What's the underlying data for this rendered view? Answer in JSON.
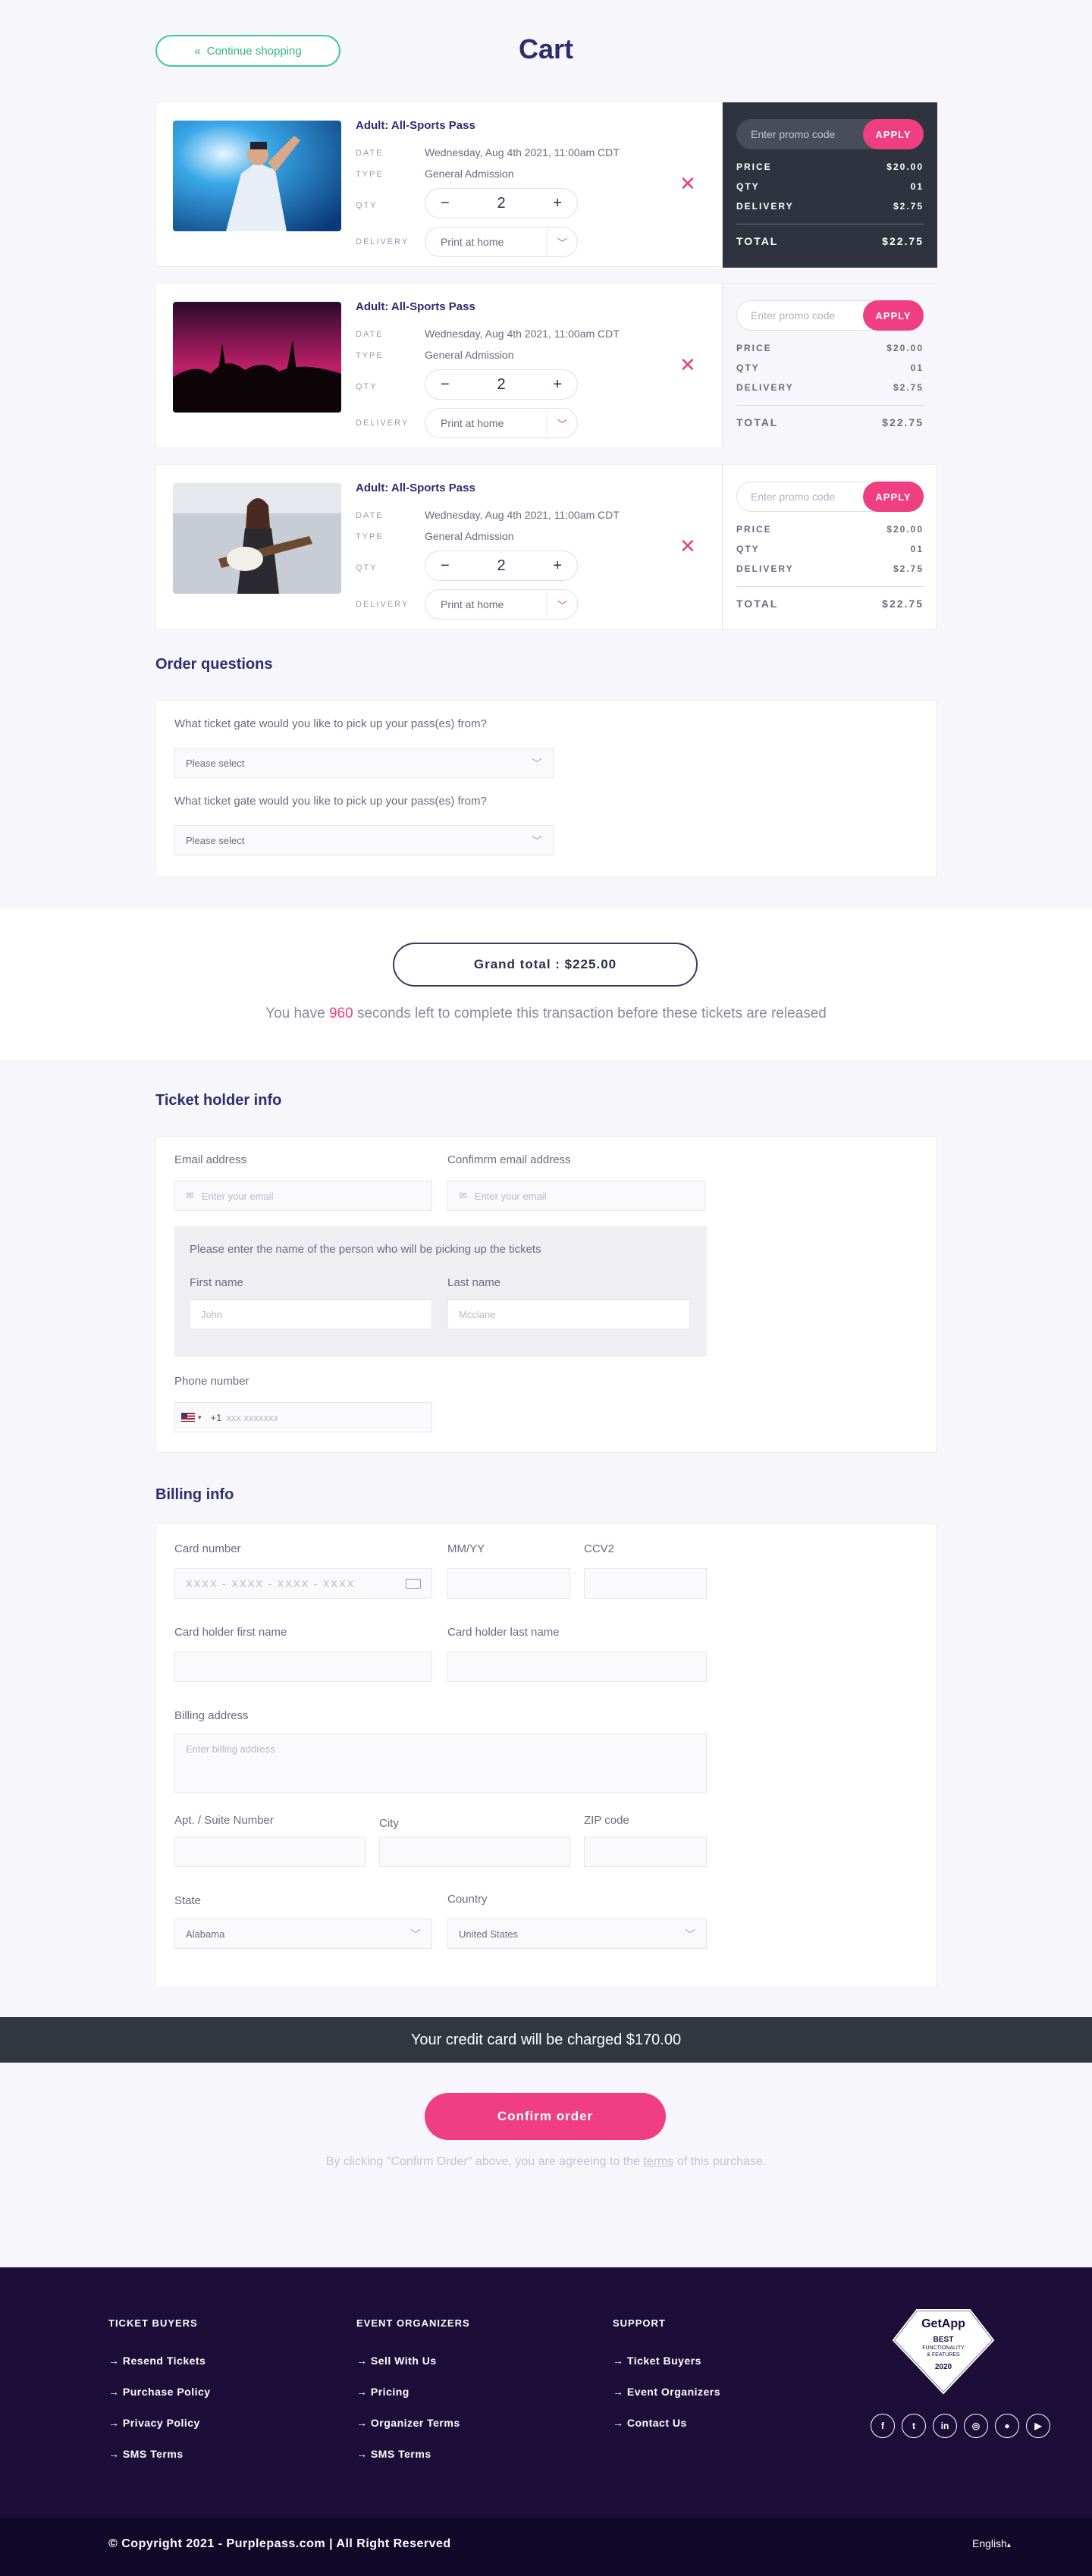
{
  "header": {
    "continue_label": "Continue shopping",
    "title": "Cart"
  },
  "items": [
    {
      "title": "Adult: All-Sports Pass",
      "date_label": "DATE",
      "date": "Wednesday, Aug 4th 2021, 11:00am CDT",
      "type_label": "TYPE",
      "type": "General Admission",
      "qty_label": "QTY",
      "qty": "2",
      "delivery_label": "DELIVERY",
      "delivery": "Print at home",
      "promo_placeholder": "Enter promo code",
      "apply": "APPLY",
      "price_label": "PRICE",
      "price": "$20.00",
      "qty_s_label": "QTY",
      "qty_s": "01",
      "deliv_s_label": "DELIVERY",
      "deliv_s": "$2.75",
      "total_label": "TOTAL",
      "total": "$22.75"
    },
    {
      "title": "Adult: All-Sports Pass",
      "date_label": "DATE",
      "date": "Wednesday, Aug 4th 2021, 11:00am CDT",
      "type_label": "TYPE",
      "type": "General Admission",
      "qty_label": "QTY",
      "qty": "2",
      "delivery_label": "DELIVERY",
      "delivery": "Print at home",
      "promo_placeholder": "Enter promo code",
      "apply": "APPLY",
      "price_label": "PRICE",
      "price": "$20.00",
      "qty_s_label": "QTY",
      "qty_s": "01",
      "deliv_s_label": "DELIVERY",
      "deliv_s": "$2.75",
      "total_label": "TOTAL",
      "total": "$22.75"
    },
    {
      "title": "Adult: All-Sports Pass",
      "date_label": "DATE",
      "date": "Wednesday, Aug 4th 2021, 11:00am CDT",
      "type_label": "TYPE",
      "type": "General Admission",
      "qty_label": "QTY",
      "qty": "2",
      "delivery_label": "DELIVERY",
      "delivery": "Print at home",
      "promo_placeholder": "Enter promo code",
      "apply": "APPLY",
      "price_label": "PRICE",
      "price": "$20.00",
      "qty_s_label": "QTY",
      "qty_s": "01",
      "deliv_s_label": "DELIVERY",
      "deliv_s": "$2.75",
      "total_label": "TOTAL",
      "total": "$22.75"
    }
  ],
  "questions": {
    "title": "Order questions",
    "q1": "What ticket gate would you like to pick up your pass(es) from?",
    "q2": "What ticket gate would you like to pick up your pass(es) from?",
    "select_placeholder": "Please select"
  },
  "grand": {
    "label": "Grand total : $225.00",
    "timer_pre": "You have ",
    "seconds": "960",
    "timer_post": " seconds left to complete this transaction before these tickets are released"
  },
  "holder": {
    "title": "Ticket holder info",
    "email_label": "Email address",
    "email_placeholder": "Enter your email",
    "confirm_label": "Confimrm email address",
    "confirm_placeholder": "Enter your email",
    "pickup_note": "Please enter the name of the person who will be picking up the tickets",
    "first_label": "First name",
    "first_placeholder": "John",
    "last_label": "Last name",
    "last_placeholder": "Mcclane",
    "phone_label": "Phone number",
    "phone_code": "+1",
    "phone_placeholder": "xxx  xxxxxxx"
  },
  "billing": {
    "title": "Billing info",
    "card_label": "Card number",
    "card_placeholder": "XXXX - XXXX - XXXX - XXXX",
    "mmyy_label": "MM/YY",
    "ccv_label": "CCV2",
    "first_label": "Card holder first name",
    "last_label": "Card holder last name",
    "address_label": "Billing address",
    "address_placeholder": "Enter billing address",
    "apt_label": "Apt. / Suite Number",
    "city_label": "City",
    "zip_label": "ZIP code",
    "state_label": "State",
    "state_value": "Alabama",
    "country_label": "Country",
    "country_value": "United States"
  },
  "charge": {
    "text": "Your credit card will be charged $170.00"
  },
  "confirm": {
    "button": "Confirm order",
    "pre": "By clicking \"Confirm Order\" above, you are agreeing to the ",
    "terms": "terms",
    "post": " of this purchase."
  },
  "footer": {
    "buyers": {
      "title": "TICKET BUYERS",
      "links": [
        "Resend Tickets",
        "Purchase Policy",
        "Privacy Policy",
        "SMS Terms"
      ]
    },
    "organizers": {
      "title": "EVENT ORGANIZERS",
      "links": [
        "Sell With Us",
        "Pricing",
        "Organizer Terms",
        "SMS Terms"
      ]
    },
    "support": {
      "title": "SUPPORT",
      "links": [
        "Ticket Buyers",
        "Event Organizers",
        "Contact Us"
      ]
    },
    "badge": {
      "brand": "GetApp",
      "line1": "BEST",
      "line2": "FUNCTIONALITY",
      "line3": "& FEATURES",
      "year": "2020"
    },
    "copyright": "© Copyright 2021 - Purplepass.com | All Right Reserved",
    "language": "English"
  },
  "colors": {
    "accent": "#ef3f80",
    "brand": "#2d2d6e",
    "green": "#3ec99a",
    "footer": "#1c0e38"
  }
}
